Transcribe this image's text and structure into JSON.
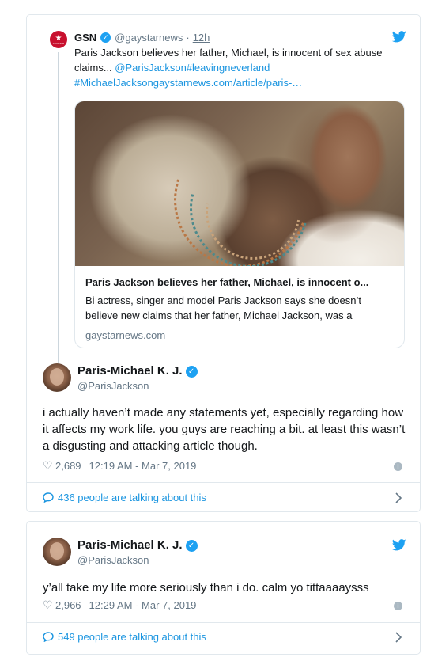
{
  "quoted": {
    "name": "GSN",
    "handle": "@gaystarnews",
    "time": "12h",
    "text_plain": "Paris Jackson believes her father, Michael, is innocent of sex abuse claims... ",
    "mention": "@ParisJackson",
    "hashtag1": "#leavingneverland",
    "hashtag2": "#MichaelJackson",
    "url": "gaystarnews.com/article/paris-…",
    "link_card": {
      "title": "Paris Jackson believes her father, Michael, is innocent o...",
      "description": "Bi actress, singer and model Paris Jackson says she doesn’t believe new claims that her father, Michael Jackson, was a",
      "domain": "gaystarnews.com"
    }
  },
  "tweet1": {
    "name": "Paris-Michael K. J.",
    "handle": "@ParisJackson",
    "text": "i actually haven’t made any statements yet, especially regarding how it affects my work life. you guys are reaching a bit. at least this wasn’t a disgusting and attacking article though.",
    "likes": "2,689",
    "timestamp": "12:19 AM - Mar 7, 2019",
    "talking": "436 people are talking about this"
  },
  "tweet2": {
    "name": "Paris-Michael K. J.",
    "handle": "@ParisJackson",
    "text": "y’all take my life more seriously than i do. calm yo tittaaaaysss",
    "likes": "2,966",
    "timestamp": "12:29 AM - Mar 7, 2019",
    "talking": "549 people are talking about this"
  },
  "icons": {
    "verified": "verified-badge-icon",
    "bird": "twitter-bird-icon",
    "heart": "heart-icon",
    "info": "info-icon",
    "comment": "speech-bubble-icon",
    "chevron": "chevron-right-icon"
  },
  "colors": {
    "twitter_blue": "#1da1f2",
    "link_blue": "#1b95e0",
    "muted": "#657786",
    "gsn_red": "#c8102e"
  }
}
